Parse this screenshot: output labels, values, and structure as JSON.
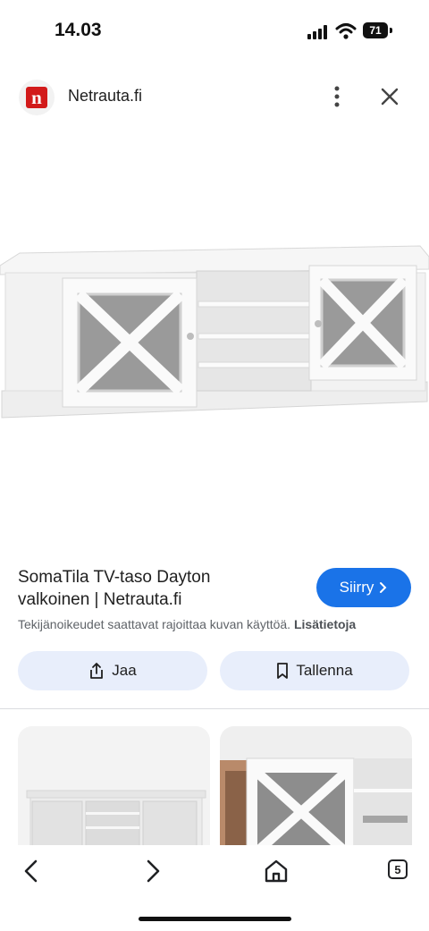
{
  "status_bar": {
    "time": "14.03",
    "battery": "71"
  },
  "header": {
    "site_name": "Netrauta.fi",
    "logo_letter": "n"
  },
  "result": {
    "title": "SomaTila TV-taso Dayton valkoinen | Netrauta.fi",
    "visit_label": "Siirry",
    "copyright_text": "Tekijänoikeudet saattavat rajoittaa kuvan käyttöä.",
    "learn_more": "Lisätietoja"
  },
  "actions": {
    "share_label": "Jaa",
    "save_label": "Tallenna"
  },
  "bottom_nav": {
    "tab_count": "5"
  },
  "colors": {
    "accent": "#1a73e8",
    "pill_bg": "#e8eefb",
    "brand_red": "#d21a1a"
  }
}
